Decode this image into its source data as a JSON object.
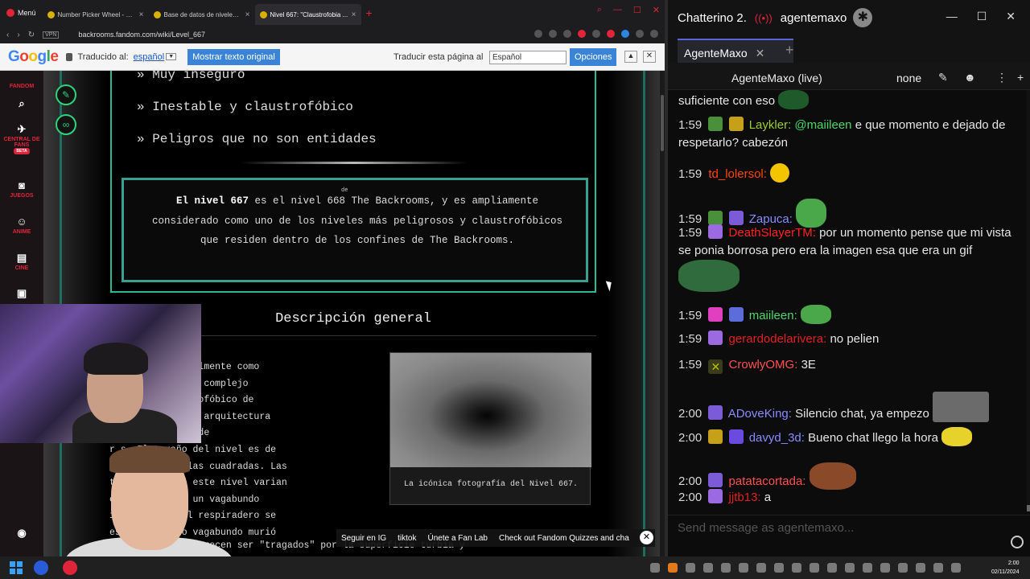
{
  "browser": {
    "menu_label": "Menú",
    "tabs": [
      {
        "label": "Number Picker Wheel - Pick"
      },
      {
        "label": "Base de datos de niveles de"
      },
      {
        "label": "Nivel 667: \"Claustrofobia ..."
      }
    ],
    "url": "backrooms.fandom.com/wiki/Level_667",
    "vpn_label": "VPN"
  },
  "translate_bar": {
    "translated_to": "Traducido al:",
    "language": "español",
    "show_original": "Mostrar texto original",
    "translate_page": "Traducir esta página al",
    "selected_language": "Español",
    "options": "Opciones"
  },
  "fandom_rail": {
    "logo": "FANDOM",
    "fan_central": "CENTRAL DE FANS",
    "beta": "BETA",
    "games": "JUEGOS",
    "anime": "ANIME",
    "movies": "CINE"
  },
  "wiki": {
    "danger_levels": [
      "» Muy inseguro",
      "» Inestable y claustrofóbico",
      "» Peligros que no son entidades"
    ],
    "summary_bold": "El nivel 667",
    "summary_rest": " es el nivel 668 The Backrooms, y es ampliamente considerado como uno de los niveles más peligrosos y claustrofóbicos que residen dentro de los confines de The Backrooms.",
    "summary_sup": "de",
    "section_title": "Descripción general",
    "body_lines": [
      "              onocido coloquialmente como",
      "              uietante , es un complejo",
      "              adamente claustrofóbico de",
      "              ectados, con una arquitectura",
      "              la de una serie de",
      "r          s. El tamaño del nivel es de",
      "           te 300,000 millas cuadradas. Las",
      "           tmosféricas de este nivel varian",
      "           ona a persona; un vagabundo",
      "i          diario que el respiradero se",
      "es         ando; dicho vagabundo murió"
    ],
    "bottom_line": "              cada vagabundo parecen ser \"tragados\" por la superficie turbia y",
    "figure_caption": "La icónica fotografía del Nivel 667."
  },
  "footer_links": [
    "Seguir en IG",
    "tiktok",
    "Únete a Fan Lab",
    "Check out Fandom Quizzes and cha"
  ],
  "chat": {
    "app_title": "Chatterino 2.",
    "account": "agentemaxo",
    "tab": "AgenteMaxo",
    "channel_header": "AgenteMaxo (live)",
    "mode": "none",
    "input_placeholder": "Send message as agentemaxo...",
    "messages": [
      {
        "time": "",
        "user": "",
        "text": "suficiente con eso",
        "user_color": "#ffffff"
      },
      {
        "time": "1:59",
        "user": "Laykler:",
        "mention": "@maiileen",
        "text": "e que momento e dejado de respetarlo? cabezón",
        "user_color": "#9acd32"
      },
      {
        "time": "1:59",
        "user": "td_lolersol:",
        "text": "",
        "user_color": "#ff4500"
      },
      {
        "time": "1:59",
        "user": "Zapuca:",
        "text": "",
        "user_color": "#8a8aff"
      },
      {
        "time": "1:59",
        "user": "DeathSlayerTM:",
        "text": "por un momento pense que mi vista se ponia borrosa pero era la imagen esa que era un gif",
        "user_color": "#ff2222"
      },
      {
        "time": "1:59",
        "user": "maiileen:",
        "text": "",
        "user_color": "#4fd66b"
      },
      {
        "time": "1:59",
        "user": "gerardodelarivera:",
        "text": "no pelien",
        "user_color": "#e02020"
      },
      {
        "time": "1:59",
        "user": "CrowlyOMG:",
        "text": "3E",
        "user_color": "#ff5050"
      },
      {
        "time": "2:00",
        "user": "ADoveKing:",
        "text": "Silencio chat, ya empezo",
        "user_color": "#8a8aff"
      },
      {
        "time": "2:00",
        "user": "davyd_3d:",
        "text": "Bueno chat llego la hora",
        "user_color": "#8a8aff"
      },
      {
        "time": "2:00",
        "user": "patatacortada:",
        "text": "",
        "user_color": "#ff5050"
      },
      {
        "time": "2:00",
        "user": "jjtb13:",
        "text": "a",
        "user_color": "#e02020"
      }
    ]
  },
  "taskbar": {
    "time": "2:00",
    "date": "02/11/2024"
  }
}
